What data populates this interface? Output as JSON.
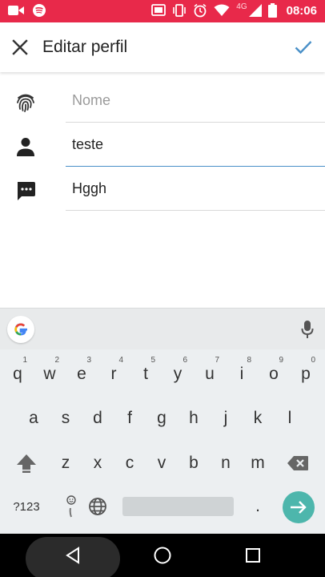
{
  "status_bar": {
    "time": "08:06",
    "network": "4G",
    "icons": [
      "video-camera-icon",
      "spotify-icon",
      "cast-icon",
      "vibrate-icon",
      "alarm-icon",
      "wifi-icon",
      "signal-icon",
      "battery-icon"
    ]
  },
  "app_bar": {
    "title": "Editar perfil",
    "close_icon": "close-icon",
    "confirm_icon": "check-icon",
    "accent": "#4a90c8"
  },
  "form": {
    "fields": [
      {
        "icon": "fingerprint-icon",
        "value": "",
        "placeholder": "Nome"
      },
      {
        "icon": "person-icon",
        "value": "teste",
        "placeholder": ""
      },
      {
        "icon": "message-icon",
        "value": "Hggh",
        "placeholder": ""
      }
    ]
  },
  "keyboard": {
    "row1": [
      {
        "key": "q",
        "hint": "1"
      },
      {
        "key": "w",
        "hint": "2"
      },
      {
        "key": "e",
        "hint": "3"
      },
      {
        "key": "r",
        "hint": "4"
      },
      {
        "key": "t",
        "hint": "5"
      },
      {
        "key": "y",
        "hint": "6"
      },
      {
        "key": "u",
        "hint": "7"
      },
      {
        "key": "i",
        "hint": "8"
      },
      {
        "key": "o",
        "hint": "9"
      },
      {
        "key": "p",
        "hint": "0"
      }
    ],
    "row2": [
      "a",
      "s",
      "d",
      "f",
      "g",
      "h",
      "j",
      "k",
      "l"
    ],
    "row3": [
      "z",
      "x",
      "c",
      "v",
      "b",
      "n",
      "m"
    ],
    "symbols_label": "?123",
    "period_label": ".",
    "enter_color": "#4db6ac"
  },
  "nav_bar": {
    "icons": [
      "back-icon",
      "home-icon",
      "recents-icon"
    ]
  },
  "colors": {
    "status_bar": "#e8294a",
    "keyboard_bg": "#eceff1"
  }
}
